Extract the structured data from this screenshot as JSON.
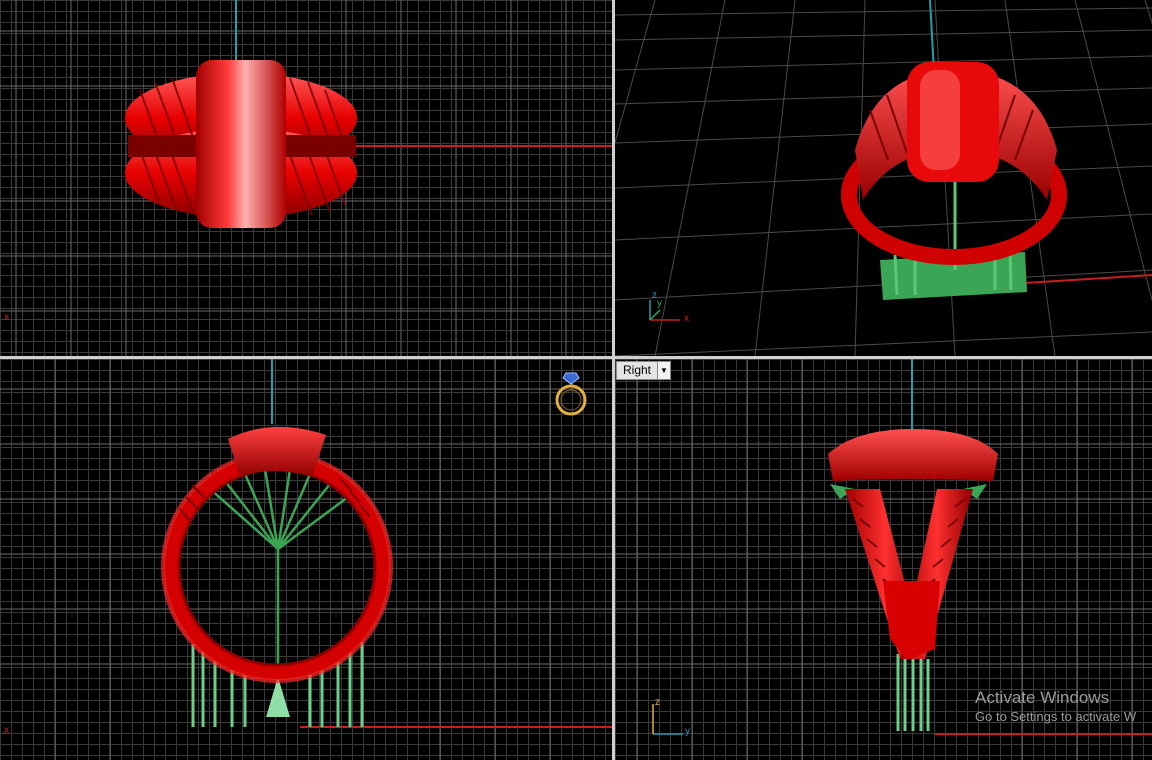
{
  "viewports": {
    "top_left": {
      "axis_label": "x"
    },
    "top_right": {
      "axis_labels": {
        "z": "z",
        "y": "y",
        "x": "x"
      }
    },
    "bottom_left": {
      "axis_label": "x",
      "gizmo_icon": "ring-view-cube-icon"
    },
    "bottom_right": {
      "view_name": "Right",
      "axis_labels": {
        "z": "z",
        "y": "y"
      }
    }
  },
  "watermark": {
    "title": "Activate Windows",
    "subtitle": "Go to Settings to activate W"
  },
  "colors": {
    "model": "#e00000",
    "support": "#3aa655",
    "axis_x": "#c81e1e",
    "axis_z": "#1fa0b0",
    "grid": "#3a3a3a",
    "divider": "#cfcfcf"
  }
}
